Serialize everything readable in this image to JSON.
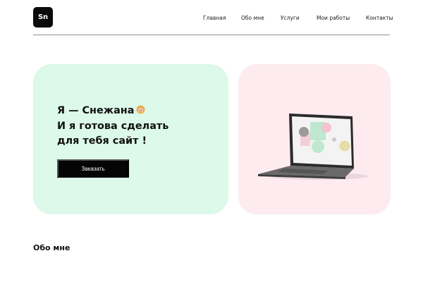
{
  "header": {
    "logo_text": "Sn",
    "nav": [
      "Главная",
      "Обо мне",
      "Услуги",
      "Мои работы",
      "Контакты"
    ]
  },
  "hero": {
    "title_lines": [
      "Я — Снежана",
      "И я готова сделать",
      "для тебя сайт !"
    ],
    "emoji_icon": "girl-emoji-icon",
    "cta_label": "Заказать"
  },
  "about": {
    "title": "Обо мне"
  },
  "colors": {
    "accent_dark": "#050505",
    "card_mint": "#dcf9e9",
    "card_pink": "#fdebf0"
  }
}
